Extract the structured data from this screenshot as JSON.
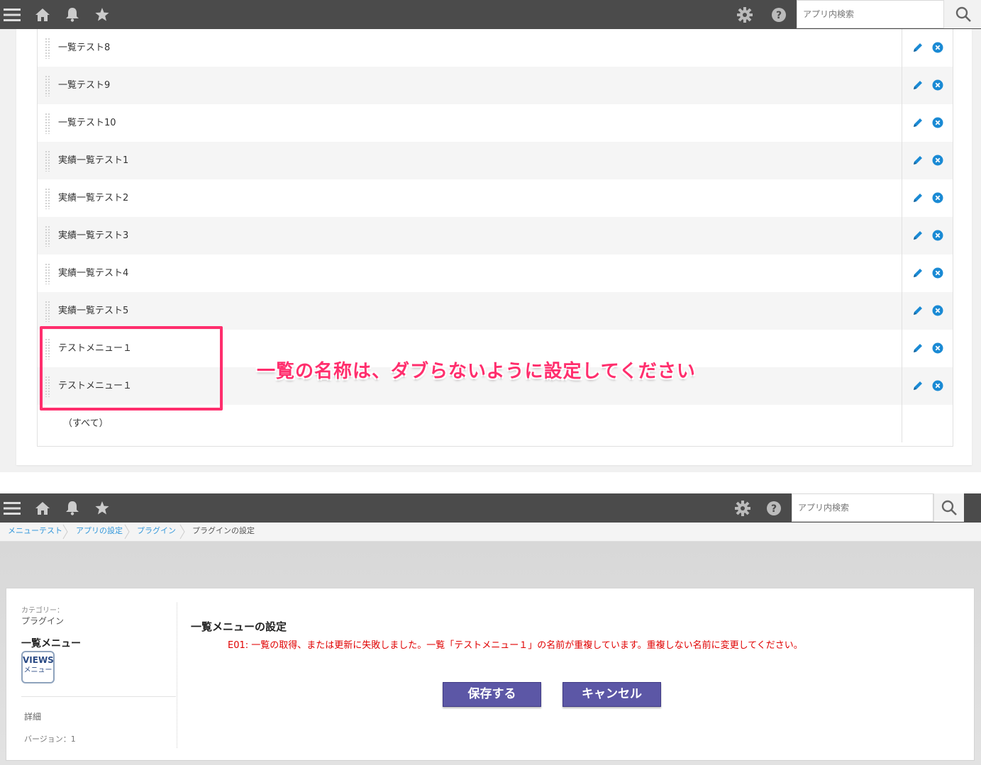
{
  "top_header": {
    "search_placeholder": "アプリ内検索"
  },
  "list": {
    "rows": [
      {
        "name": "一覧テスト8"
      },
      {
        "name": "一覧テスト9"
      },
      {
        "name": "一覧テスト10"
      },
      {
        "name": "実績一覧テスト1"
      },
      {
        "name": "実績一覧テスト2"
      },
      {
        "name": "実績一覧テスト3"
      },
      {
        "name": "実績一覧テスト4"
      },
      {
        "name": "実績一覧テスト5"
      },
      {
        "name": "テストメニュー１"
      },
      {
        "name": "テストメニュー１"
      }
    ],
    "all_row": "（すべて）"
  },
  "annotation": {
    "text": "一覧の名称は、ダブらないように設定してください",
    "color": "#ff2e6d"
  },
  "bottom_header": {
    "search_placeholder": "アプリ内検索"
  },
  "breadcrumb": {
    "items": [
      "メニューテスト",
      "アプリの設定",
      "プラグイン"
    ],
    "current": "プラグインの設定"
  },
  "sidebar": {
    "category_label": "カテゴリー：",
    "category_value": "プラグイン",
    "plugin_name": "一覧メニュー",
    "icon_line1": "VIEWS",
    "icon_line2": "メニュー",
    "detail": "詳細",
    "version": "バージョン：1"
  },
  "main": {
    "title": "一覧メニューの設定",
    "error": "E01: 一覧の取得、または更新に失敗しました。一覧「テストメニュー１」の名前が重複しています。重複しない名前に変更してください。",
    "save_label": "保存する",
    "cancel_label": "キャンセル"
  },
  "colors": {
    "header_bg": "#4b4b4b",
    "accent_blue": "#1a8ad4",
    "button_purple": "#5c57a6",
    "error_red": "#e00000"
  }
}
